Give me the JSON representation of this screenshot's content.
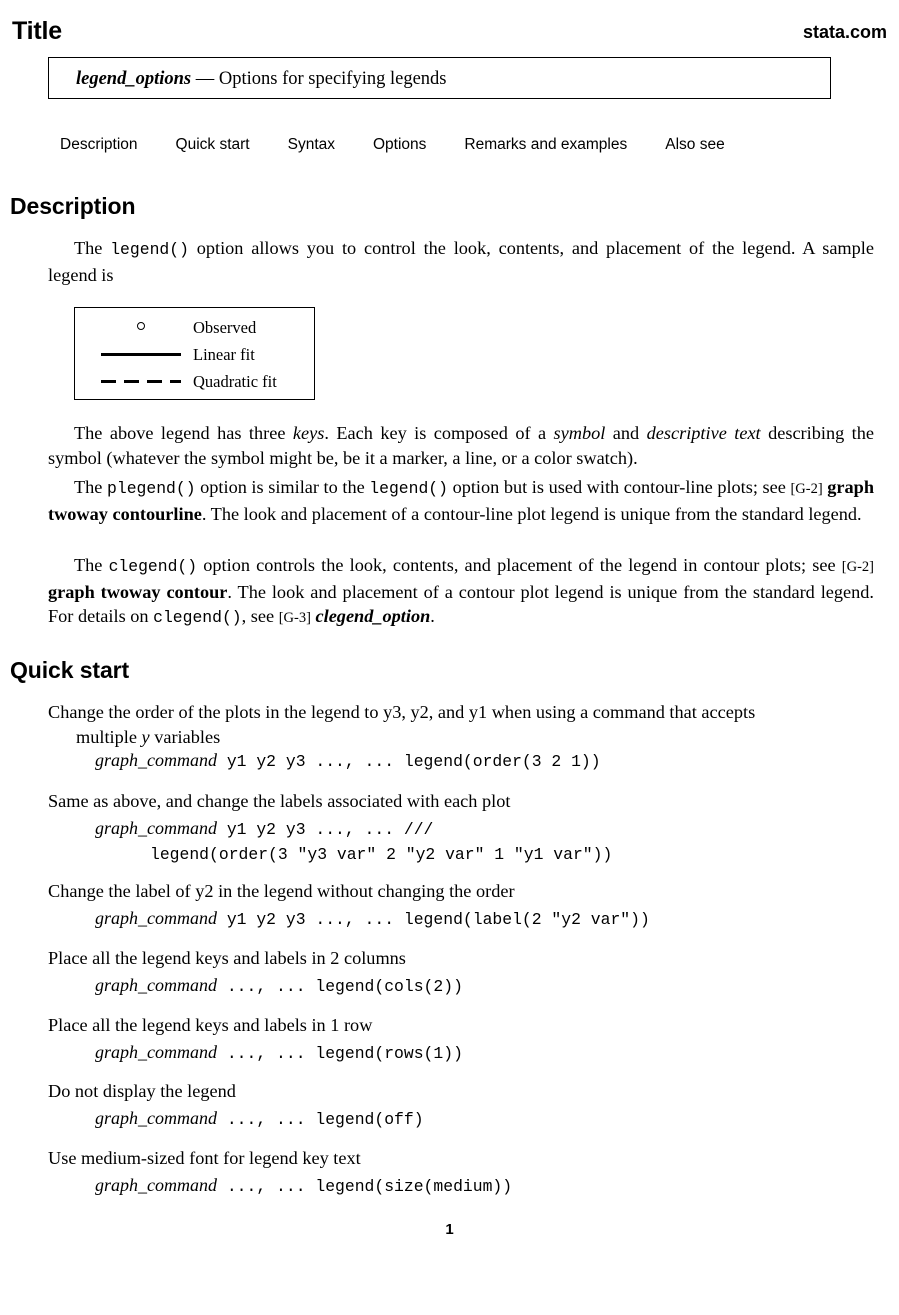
{
  "header": {
    "title": "Title",
    "site": "stata.com"
  },
  "title_box": {
    "command": "legend_options",
    "dash": "—",
    "description": "Options for specifying legends"
  },
  "nav": {
    "items": [
      {
        "label": "Description"
      },
      {
        "label": "Quick start"
      },
      {
        "label": "Syntax"
      },
      {
        "label": "Options"
      },
      {
        "label": "Remarks and examples"
      },
      {
        "label": "Also see"
      }
    ]
  },
  "sections": {
    "description_heading": "Description",
    "quickstart_heading": "Quick start"
  },
  "description": {
    "para1": {
      "a": "The ",
      "code1": "legend()",
      "b": " option allows you to control the look, contents, and placement of the legend. A sample legend is"
    },
    "para2": {
      "a": "The above legend has three ",
      "i1": "keys",
      "b": ". Each key is composed of a ",
      "i2": "symbol",
      "c": " and ",
      "i3": "descriptive text",
      "d": " describing the symbol (whatever the symbol might be, be it a marker, a line, or a color swatch)."
    },
    "para3": {
      "a": "The ",
      "code1": "plegend()",
      "b": " option is similar to the ",
      "code2": "legend()",
      "c": " option but is used with contour-line plots; see ",
      "ref": "[G-2]",
      "d": " ",
      "refname": "graph twoway contourline",
      "e": ". The look and placement of a contour-line plot legend is unique from the standard legend."
    },
    "para4": {
      "a": "The ",
      "code1": "clegend()",
      "b": " option controls the look, contents, and placement of the legend in contour plots; see ",
      "ref": "[G-2]",
      "c": " ",
      "refname": "graph twoway contour",
      "d": ". The look and placement of a contour plot legend is unique from the standard legend. For details on ",
      "code2": "clegend()",
      "e": ", see ",
      "ref2": "[G-3]",
      "f": " ",
      "refname2": "clegend_option",
      "g": "."
    }
  },
  "sample_legend": {
    "keys": [
      {
        "symbol": "marker-circle",
        "label": "Observed"
      },
      {
        "symbol": "line-solid",
        "label": "Linear fit"
      },
      {
        "symbol": "line-dashed",
        "label": "Quadratic fit"
      }
    ]
  },
  "quick_start": {
    "entries": [
      {
        "desc": "Change the order of the plots in the legend to y3, y2, and y1 when using a command that accepts",
        "desc_cont": "multiple y variables",
        "code_cmd": "graph_command",
        "code_rest": " y1 y2 y3 ..., ... legend(order(3 2 1))",
        "code_cont": ""
      },
      {
        "desc": "Same as above, and change the labels associated with each plot",
        "desc_cont": "",
        "code_cmd": "graph_command",
        "code_rest": " y1 y2 y3 ..., ...  ///",
        "code_cont": "legend(order(3 \"y3 var\" 2 \"y2 var\" 1 \"y1 var\"))"
      },
      {
        "desc": "Change the label of y2 in the legend without changing the order",
        "desc_cont": "",
        "code_cmd": "graph_command",
        "code_rest": " y1 y2 y3 ..., ... legend(label(2 \"y2 var\"))",
        "code_cont": ""
      },
      {
        "desc": "Place all the legend keys and labels in 2 columns",
        "desc_cont": "",
        "code_cmd": "graph_command",
        "code_rest": " ..., ... legend(cols(2))",
        "code_cont": ""
      },
      {
        "desc": "Place all the legend keys and labels in 1 row",
        "desc_cont": "",
        "code_cmd": "graph_command",
        "code_rest": " ..., ... legend(rows(1))",
        "code_cont": ""
      },
      {
        "desc": "Do not display the legend",
        "desc_cont": "",
        "code_cmd": "graph_command",
        "code_rest": " ..., ... legend(off)",
        "code_cont": ""
      },
      {
        "desc": "Use medium-sized font for legend key text",
        "desc_cont": "",
        "code_cmd": "graph_command",
        "code_rest": " ..., ... legend(size(medium))",
        "code_cont": ""
      }
    ]
  },
  "footer": {
    "page_number": "1"
  }
}
